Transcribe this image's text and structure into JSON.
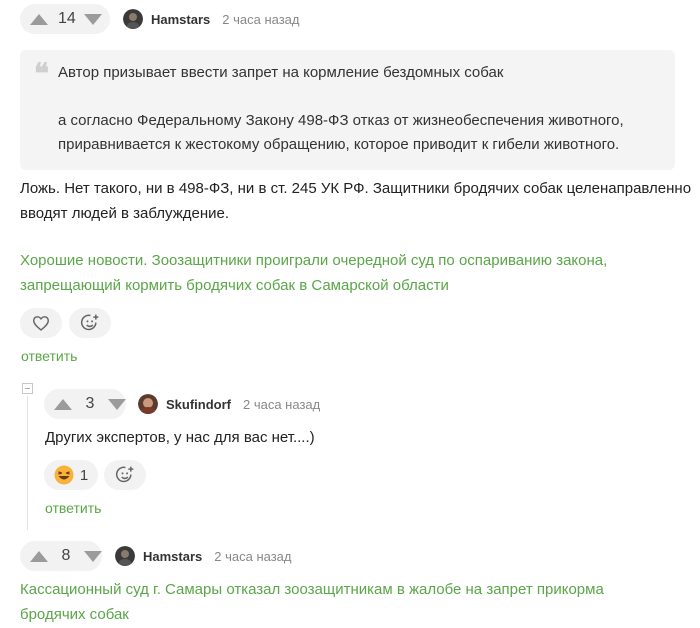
{
  "comment1": {
    "votes": "14",
    "author": "Hamstars",
    "time": "2 часа назад",
    "quote_mark": "❝",
    "quote_line1": "Автор призывает ввести запрет на кормление бездомных собак",
    "quote_line2": "а согласно Федеральному Закону 498-ФЗ отказ от жизнеобеспечения животного,",
    "quote_line3": "приравнивается к жестокому обращению, которое приводит к гибели животного.",
    "text_line1": "Ложь. Нет такого, ни в 498-ФЗ, ни в ст. 245 УК РФ. Защитники бродячих собак целенаправленно",
    "text_line2": "вводят людей в заблуждение.",
    "link_line1": "Хорошие новости. Зоозащитники проиграли очередной суд по оспариванию закона,",
    "link_line2": "запрещающий кормить бродячих собак в Самарской области",
    "reply_label": "ответить",
    "heart_icon": "heart-outline",
    "emoji_icon": "add-emoji"
  },
  "comment2": {
    "votes": "3",
    "author": "Skufindorf",
    "time": "2 часа назад",
    "text": "Других экспертов, у нас для вас нет....)",
    "reaction_count": "1",
    "reaction_icon": "laughing-emoji",
    "emoji_icon": "add-emoji",
    "reply_label": "ответить"
  },
  "comment3": {
    "votes": "8",
    "author": "Hamstars",
    "time": "2 часа назад",
    "link_line1": "Кассационный суд г. Самары отказал зоозащитникам в жалобе на запрет прикорма",
    "link_line2": "бродячих собак"
  },
  "colors": {
    "link_green": "#5aa648",
    "pill_bg": "#f2f2f2",
    "quote_bg": "#f4f4f4"
  }
}
